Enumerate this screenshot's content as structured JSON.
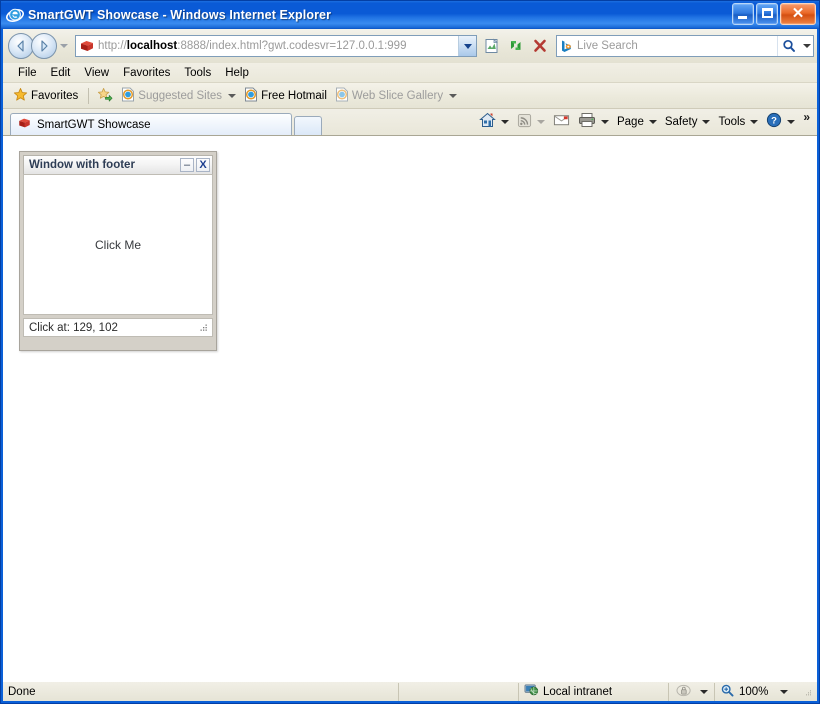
{
  "window": {
    "title": "SmartGWT Showcase - Windows Internet Explorer",
    "icon": "internet-explorer-icon",
    "caption_buttons": {
      "minimize": "Minimize",
      "maximize": "Maximize",
      "close": "Close"
    }
  },
  "navbar": {
    "back": "Back",
    "forward": "Forward",
    "history_dropdown": "Recent Pages",
    "address": {
      "favicon": "smartgwt-red-box-icon",
      "scheme": "http://",
      "host": "localhost",
      "rest": ":8888/index.html?gwt.codesvr=127.0.0.1:999",
      "full": "http://localhost:8888/index.html?gwt.codesvr=127.0.0.1:999",
      "dropdown": "Address dropdown"
    },
    "buttons": [
      {
        "name": "compatibility-view-icon",
        "label": "Compatibility View"
      },
      {
        "name": "refresh-icon",
        "label": "Refresh"
      },
      {
        "name": "stop-icon",
        "label": "Stop"
      }
    ],
    "search": {
      "placeholder": "Live Search",
      "provider_icon": "bing-b-icon",
      "go": "Search",
      "dropdown": "Search options"
    }
  },
  "menubar": {
    "items": [
      "File",
      "Edit",
      "View",
      "Favorites",
      "Tools",
      "Help"
    ]
  },
  "favbar": {
    "favorites": {
      "label": "Favorites",
      "icon": "star-icon"
    },
    "add_to_favorites": {
      "icon": "add-favorite-icon"
    },
    "items": [
      {
        "label": "Suggested Sites",
        "icon": "ie-page-icon",
        "dim": true,
        "dropdown": true
      },
      {
        "label": "Free Hotmail",
        "icon": "ie-page-icon",
        "dim": false,
        "dropdown": false
      },
      {
        "label": "Web Slice Gallery",
        "icon": "ie-page-icon",
        "dim": true,
        "dropdown": true
      }
    ]
  },
  "tabs": {
    "items": [
      {
        "label": "SmartGWT Showcase",
        "icon": "smartgwt-red-box-icon",
        "active": true
      }
    ],
    "new_tab": "New Tab"
  },
  "commandbar": {
    "items": [
      {
        "name": "home-button",
        "label": "",
        "icon": "home-icon",
        "dropdown": true,
        "dim": false
      },
      {
        "name": "feeds-button",
        "label": "",
        "icon": "rss-icon",
        "dropdown": true,
        "dim": true
      },
      {
        "name": "read-mail-button",
        "label": "",
        "icon": "mail-icon",
        "dropdown": false,
        "dim": false
      },
      {
        "name": "print-button",
        "label": "",
        "icon": "printer-icon",
        "dropdown": true,
        "dim": false
      },
      {
        "name": "page-button",
        "label": "Page",
        "icon": "",
        "dropdown": true,
        "dim": false
      },
      {
        "name": "safety-button",
        "label": "Safety",
        "icon": "",
        "dropdown": true,
        "dim": false
      },
      {
        "name": "tools-button",
        "label": "Tools",
        "icon": "",
        "dropdown": true,
        "dim": false
      },
      {
        "name": "help-button",
        "label": "",
        "icon": "help-icon",
        "dropdown": true,
        "dim": false
      }
    ],
    "overflow": "»"
  },
  "page": {
    "sgwt_window": {
      "title": "Window with footer",
      "minimize_label": "–",
      "close_label": "X",
      "body_text": "Click Me",
      "footer_text": "Click at: 129, 102",
      "resize_grip": "resize-grip-icon"
    }
  },
  "statusbar": {
    "status": "Done",
    "zone": {
      "label": "Local intranet",
      "icon": "local-intranet-icon"
    },
    "protected_mode": {
      "icon": "lock-icon",
      "dropdown": true
    },
    "zoom": {
      "label": "100%",
      "icon": "zoom-icon",
      "dropdown": true
    },
    "resize_grip": "resize-grip-icon"
  },
  "colors": {
    "titlebar_blue": "#0a5ad6",
    "frame_blue": "#0a60d8",
    "chrome_beige": "#e8e6d8",
    "sgwt_title_text": "#2e3d55",
    "page_background": "#ffffff"
  }
}
